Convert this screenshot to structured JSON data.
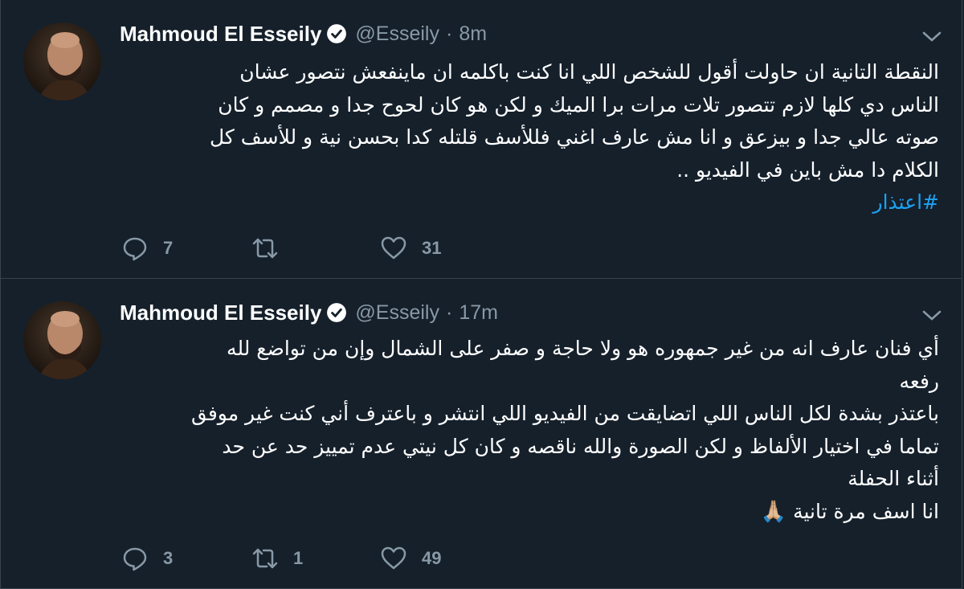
{
  "tweets": [
    {
      "author_name": "Mahmoud El Esseily",
      "handle": "@Esseily",
      "separator": "·",
      "time": "8m",
      "lines": [
        "النقطة التانية ان حاولت أقول للشخص اللي انا كنت باكلمه ان ماينفعش نتصور عشان",
        "الناس دي كلها لازم تتصور تلات مرات برا الميك و لكن هو كان لحوح جدا و مصمم و كان",
        "صوته عالي جدا و بيزعق و انا مش عارف اغني فللأسف قلتله كدا بحسن نية و للأسف كل",
        "الكلام دا مش باين في الفيديو .."
      ],
      "hashtag": "#اعتذار",
      "replies": "7",
      "retweets": "",
      "likes": "31"
    },
    {
      "author_name": "Mahmoud El Esseily",
      "handle": "@Esseily",
      "separator": "·",
      "time": "17m",
      "lines": [
        "أي فنان عارف انه من غير جمهوره هو ولا حاجة و صفر على الشمال وإن من تواضع لله",
        "رفعه",
        "باعتذر بشدة لكل الناس اللي اتضايقت من الفيديو اللي انتشر و باعترف أني كنت غير موفق",
        "تماما في اختيار الألفاظ و لكن الصورة والله ناقصه و كان كل نيتي عدم تمييز حد عن حد",
        "أثناء الحفلة"
      ],
      "last_line_text": "انا اسف مرة تانية",
      "last_line_emoji": "🙏🏼",
      "replies": "3",
      "retweets": "1",
      "likes": "49"
    }
  ],
  "icons": {
    "verified": "verified-badge-icon",
    "menu": "chevron-down-icon",
    "reply": "reply-icon",
    "retweet": "retweet-icon",
    "like": "heart-icon"
  },
  "colors": {
    "background": "#15202b",
    "secondary_text": "#8899a6",
    "link": "#1da1f2",
    "border": "#38444d"
  }
}
